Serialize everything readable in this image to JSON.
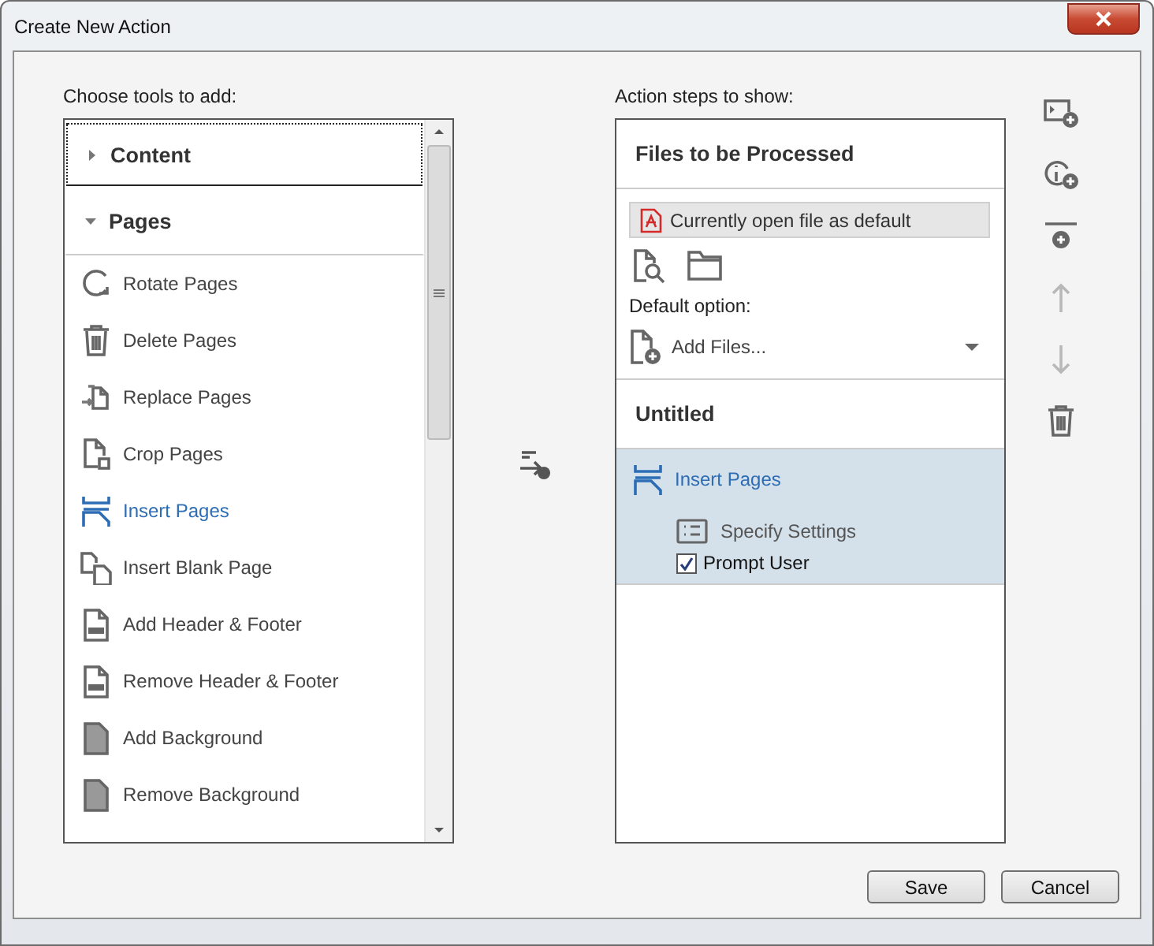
{
  "window": {
    "title": "Create New Action"
  },
  "tools": {
    "label": "Choose tools to add:",
    "groups": [
      {
        "name": "Content",
        "expanded": false,
        "focused": true
      },
      {
        "name": "Pages",
        "expanded": true,
        "focused": false,
        "children": [
          {
            "label": "Rotate Pages",
            "kind": "rotate",
            "selected": false
          },
          {
            "label": "Delete Pages",
            "kind": "trash",
            "selected": false
          },
          {
            "label": "Replace Pages",
            "kind": "replace",
            "selected": false
          },
          {
            "label": "Crop Pages",
            "kind": "crop",
            "selected": false
          },
          {
            "label": "Insert Pages",
            "kind": "insert",
            "selected": true
          },
          {
            "label": "Insert Blank Page",
            "kind": "blank",
            "selected": false
          },
          {
            "label": "Add Header & Footer",
            "kind": "header",
            "selected": false
          },
          {
            "label": "Remove Header & Footer",
            "kind": "header",
            "selected": false
          },
          {
            "label": "Add Background",
            "kind": "background",
            "selected": false
          },
          {
            "label": "Remove Background",
            "kind": "background",
            "selected": false
          }
        ]
      }
    ]
  },
  "steps": {
    "label": "Action steps to show:",
    "files": {
      "title": "Files to be Processed",
      "source": "Currently open file as default",
      "default_label": "Default option:",
      "default_value": "Add Files..."
    },
    "action": {
      "title": "Untitled",
      "steps": [
        {
          "label": "Insert Pages",
          "selected": true,
          "settings": "Specify Settings",
          "prompt": {
            "label": "Prompt User",
            "checked": true
          }
        }
      ]
    }
  },
  "side_tools": [
    {
      "kind": "add-media",
      "disabled": false
    },
    {
      "kind": "add-info",
      "disabled": false
    },
    {
      "kind": "add-divider",
      "disabled": false
    },
    {
      "kind": "move-up",
      "disabled": true
    },
    {
      "kind": "move-down",
      "disabled": true
    },
    {
      "kind": "delete",
      "disabled": false
    }
  ],
  "buttons": [
    "Save",
    "Cancel"
  ]
}
